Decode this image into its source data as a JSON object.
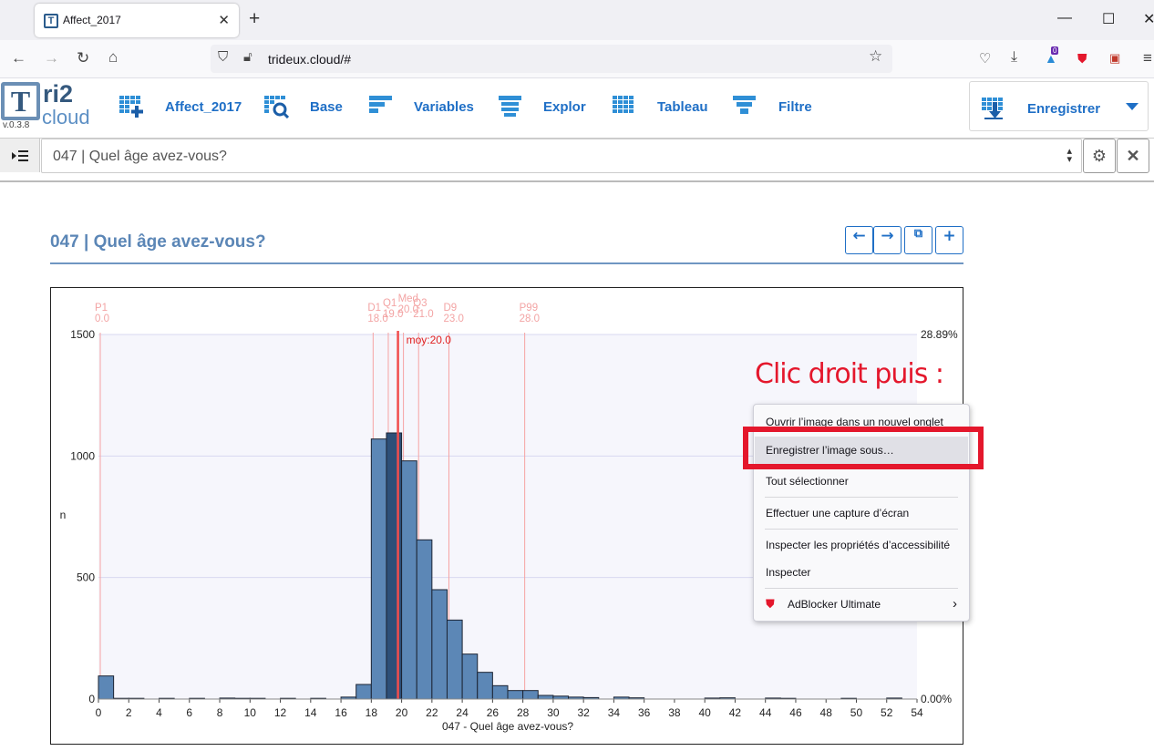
{
  "browser": {
    "tab_title": "Affect_2017",
    "url": "trideux.cloud/#",
    "extension_badge": "0",
    "new_tab": "+",
    "close": "✕",
    "min": "—",
    "max": "☐",
    "win_close": "✕"
  },
  "app": {
    "logo_t": "T",
    "logo_ri2": "ri2",
    "logo_cloud": "cloud",
    "version": "v.0.3.8",
    "toolbar": [
      {
        "label": "Affect_2017",
        "icon": "grid-plus-icon"
      },
      {
        "label": "Base",
        "icon": "grid-search-icon"
      },
      {
        "label": "Variables",
        "icon": "bars-icon"
      },
      {
        "label": "Explor",
        "icon": "stacked-bars-icon"
      },
      {
        "label": "Tableau",
        "icon": "table-icon"
      },
      {
        "label": "Filtre",
        "icon": "funnel-icon"
      }
    ],
    "save_label": "Enregistrer",
    "selector_value": "047 | Quel âge avez-vous?"
  },
  "page": {
    "title": "047 | Quel âge avez-vous?"
  },
  "chart_data": {
    "type": "bar",
    "title": "",
    "xlabel": "047 - Quel âge avez-vous?",
    "ylabel": "n",
    "ylim": [
      0,
      1500
    ],
    "yticks": [
      0,
      500,
      1000,
      1500
    ],
    "y2_top": "28.89%",
    "y2_bottom": "0.00%",
    "xlim": [
      0,
      54
    ],
    "xticks": [
      0,
      2,
      4,
      6,
      8,
      10,
      12,
      14,
      16,
      18,
      20,
      22,
      24,
      26,
      28,
      30,
      32,
      34,
      36,
      38,
      40,
      42,
      44,
      46,
      48,
      50,
      52,
      54
    ],
    "bins": [
      {
        "x": 0,
        "n": 95
      },
      {
        "x": 1,
        "n": 3
      },
      {
        "x": 2,
        "n": 3
      },
      {
        "x": 4,
        "n": 3
      },
      {
        "x": 6,
        "n": 3
      },
      {
        "x": 8,
        "n": 4
      },
      {
        "x": 9,
        "n": 3
      },
      {
        "x": 10,
        "n": 3
      },
      {
        "x": 12,
        "n": 3
      },
      {
        "x": 14,
        "n": 3
      },
      {
        "x": 16,
        "n": 8
      },
      {
        "x": 17,
        "n": 60
      },
      {
        "x": 18,
        "n": 1070
      },
      {
        "x": 19,
        "n": 1095
      },
      {
        "x": 20,
        "n": 980
      },
      {
        "x": 21,
        "n": 655
      },
      {
        "x": 22,
        "n": 450
      },
      {
        "x": 23,
        "n": 325
      },
      {
        "x": 24,
        "n": 185
      },
      {
        "x": 25,
        "n": 110
      },
      {
        "x": 26,
        "n": 55
      },
      {
        "x": 27,
        "n": 35
      },
      {
        "x": 28,
        "n": 35
      },
      {
        "x": 29,
        "n": 15
      },
      {
        "x": 30,
        "n": 12
      },
      {
        "x": 31,
        "n": 8
      },
      {
        "x": 32,
        "n": 6
      },
      {
        "x": 34,
        "n": 8
      },
      {
        "x": 35,
        "n": 5
      },
      {
        "x": 40,
        "n": 4
      },
      {
        "x": 41,
        "n": 5
      },
      {
        "x": 44,
        "n": 4
      },
      {
        "x": 45,
        "n": 3
      },
      {
        "x": 49,
        "n": 3
      },
      {
        "x": 52,
        "n": 4
      }
    ],
    "highlight_bin": 19,
    "bar_color": "#5c87b6",
    "highlight_color": "#2d4f78",
    "quantiles": [
      {
        "label": "P1",
        "value": "0.0",
        "x": 0
      },
      {
        "label": "D1",
        "value": "18.0",
        "x": 18
      },
      {
        "label": "Q1",
        "value": "19.0",
        "x": 19
      },
      {
        "label": "Med",
        "value": "20.0",
        "x": 20
      },
      {
        "label": "Q3",
        "value": "21.0",
        "x": 21
      },
      {
        "label": "D9",
        "value": "23.0",
        "x": 23
      },
      {
        "label": "P99",
        "value": "28.0",
        "x": 28
      }
    ],
    "mean": {
      "label": "moy:20.0",
      "x": 20
    }
  },
  "annotation": "Clic droit puis :",
  "context_menu": [
    {
      "label": "Ouvrir l’image dans un nouvel onglet"
    },
    {
      "label": "Enregistrer l’image sous…",
      "highlighted": true
    },
    {
      "label": "Tout sélectionner"
    },
    {
      "label": "Effectuer une capture d’écran"
    },
    {
      "label": "Inspecter les propriétés d’accessibilité"
    },
    {
      "label": "Inspecter"
    },
    {
      "label": "AdBlocker Ultimate"
    }
  ]
}
